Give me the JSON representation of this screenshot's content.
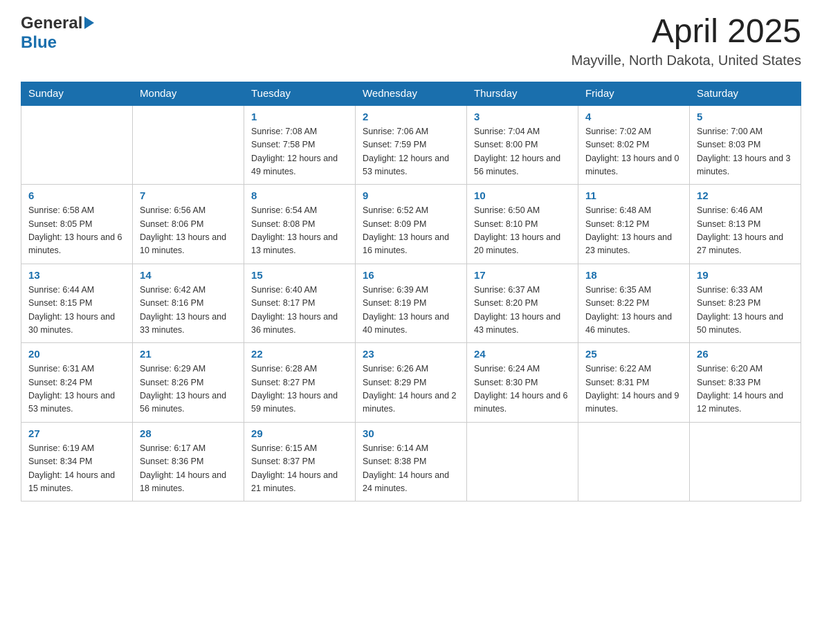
{
  "header": {
    "logo_text_general": "General",
    "logo_text_blue": "Blue",
    "month_title": "April 2025",
    "location": "Mayville, North Dakota, United States"
  },
  "weekdays": [
    "Sunday",
    "Monday",
    "Tuesday",
    "Wednesday",
    "Thursday",
    "Friday",
    "Saturday"
  ],
  "weeks": [
    [
      {
        "day": "",
        "sunrise": "",
        "sunset": "",
        "daylight": ""
      },
      {
        "day": "",
        "sunrise": "",
        "sunset": "",
        "daylight": ""
      },
      {
        "day": "1",
        "sunrise": "Sunrise: 7:08 AM",
        "sunset": "Sunset: 7:58 PM",
        "daylight": "Daylight: 12 hours and 49 minutes."
      },
      {
        "day": "2",
        "sunrise": "Sunrise: 7:06 AM",
        "sunset": "Sunset: 7:59 PM",
        "daylight": "Daylight: 12 hours and 53 minutes."
      },
      {
        "day": "3",
        "sunrise": "Sunrise: 7:04 AM",
        "sunset": "Sunset: 8:00 PM",
        "daylight": "Daylight: 12 hours and 56 minutes."
      },
      {
        "day": "4",
        "sunrise": "Sunrise: 7:02 AM",
        "sunset": "Sunset: 8:02 PM",
        "daylight": "Daylight: 13 hours and 0 minutes."
      },
      {
        "day": "5",
        "sunrise": "Sunrise: 7:00 AM",
        "sunset": "Sunset: 8:03 PM",
        "daylight": "Daylight: 13 hours and 3 minutes."
      }
    ],
    [
      {
        "day": "6",
        "sunrise": "Sunrise: 6:58 AM",
        "sunset": "Sunset: 8:05 PM",
        "daylight": "Daylight: 13 hours and 6 minutes."
      },
      {
        "day": "7",
        "sunrise": "Sunrise: 6:56 AM",
        "sunset": "Sunset: 8:06 PM",
        "daylight": "Daylight: 13 hours and 10 minutes."
      },
      {
        "day": "8",
        "sunrise": "Sunrise: 6:54 AM",
        "sunset": "Sunset: 8:08 PM",
        "daylight": "Daylight: 13 hours and 13 minutes."
      },
      {
        "day": "9",
        "sunrise": "Sunrise: 6:52 AM",
        "sunset": "Sunset: 8:09 PM",
        "daylight": "Daylight: 13 hours and 16 minutes."
      },
      {
        "day": "10",
        "sunrise": "Sunrise: 6:50 AM",
        "sunset": "Sunset: 8:10 PM",
        "daylight": "Daylight: 13 hours and 20 minutes."
      },
      {
        "day": "11",
        "sunrise": "Sunrise: 6:48 AM",
        "sunset": "Sunset: 8:12 PM",
        "daylight": "Daylight: 13 hours and 23 minutes."
      },
      {
        "day": "12",
        "sunrise": "Sunrise: 6:46 AM",
        "sunset": "Sunset: 8:13 PM",
        "daylight": "Daylight: 13 hours and 27 minutes."
      }
    ],
    [
      {
        "day": "13",
        "sunrise": "Sunrise: 6:44 AM",
        "sunset": "Sunset: 8:15 PM",
        "daylight": "Daylight: 13 hours and 30 minutes."
      },
      {
        "day": "14",
        "sunrise": "Sunrise: 6:42 AM",
        "sunset": "Sunset: 8:16 PM",
        "daylight": "Daylight: 13 hours and 33 minutes."
      },
      {
        "day": "15",
        "sunrise": "Sunrise: 6:40 AM",
        "sunset": "Sunset: 8:17 PM",
        "daylight": "Daylight: 13 hours and 36 minutes."
      },
      {
        "day": "16",
        "sunrise": "Sunrise: 6:39 AM",
        "sunset": "Sunset: 8:19 PM",
        "daylight": "Daylight: 13 hours and 40 minutes."
      },
      {
        "day": "17",
        "sunrise": "Sunrise: 6:37 AM",
        "sunset": "Sunset: 8:20 PM",
        "daylight": "Daylight: 13 hours and 43 minutes."
      },
      {
        "day": "18",
        "sunrise": "Sunrise: 6:35 AM",
        "sunset": "Sunset: 8:22 PM",
        "daylight": "Daylight: 13 hours and 46 minutes."
      },
      {
        "day": "19",
        "sunrise": "Sunrise: 6:33 AM",
        "sunset": "Sunset: 8:23 PM",
        "daylight": "Daylight: 13 hours and 50 minutes."
      }
    ],
    [
      {
        "day": "20",
        "sunrise": "Sunrise: 6:31 AM",
        "sunset": "Sunset: 8:24 PM",
        "daylight": "Daylight: 13 hours and 53 minutes."
      },
      {
        "day": "21",
        "sunrise": "Sunrise: 6:29 AM",
        "sunset": "Sunset: 8:26 PM",
        "daylight": "Daylight: 13 hours and 56 minutes."
      },
      {
        "day": "22",
        "sunrise": "Sunrise: 6:28 AM",
        "sunset": "Sunset: 8:27 PM",
        "daylight": "Daylight: 13 hours and 59 minutes."
      },
      {
        "day": "23",
        "sunrise": "Sunrise: 6:26 AM",
        "sunset": "Sunset: 8:29 PM",
        "daylight": "Daylight: 14 hours and 2 minutes."
      },
      {
        "day": "24",
        "sunrise": "Sunrise: 6:24 AM",
        "sunset": "Sunset: 8:30 PM",
        "daylight": "Daylight: 14 hours and 6 minutes."
      },
      {
        "day": "25",
        "sunrise": "Sunrise: 6:22 AM",
        "sunset": "Sunset: 8:31 PM",
        "daylight": "Daylight: 14 hours and 9 minutes."
      },
      {
        "day": "26",
        "sunrise": "Sunrise: 6:20 AM",
        "sunset": "Sunset: 8:33 PM",
        "daylight": "Daylight: 14 hours and 12 minutes."
      }
    ],
    [
      {
        "day": "27",
        "sunrise": "Sunrise: 6:19 AM",
        "sunset": "Sunset: 8:34 PM",
        "daylight": "Daylight: 14 hours and 15 minutes."
      },
      {
        "day": "28",
        "sunrise": "Sunrise: 6:17 AM",
        "sunset": "Sunset: 8:36 PM",
        "daylight": "Daylight: 14 hours and 18 minutes."
      },
      {
        "day": "29",
        "sunrise": "Sunrise: 6:15 AM",
        "sunset": "Sunset: 8:37 PM",
        "daylight": "Daylight: 14 hours and 21 minutes."
      },
      {
        "day": "30",
        "sunrise": "Sunrise: 6:14 AM",
        "sunset": "Sunset: 8:38 PM",
        "daylight": "Daylight: 14 hours and 24 minutes."
      },
      {
        "day": "",
        "sunrise": "",
        "sunset": "",
        "daylight": ""
      },
      {
        "day": "",
        "sunrise": "",
        "sunset": "",
        "daylight": ""
      },
      {
        "day": "",
        "sunrise": "",
        "sunset": "",
        "daylight": ""
      }
    ]
  ]
}
